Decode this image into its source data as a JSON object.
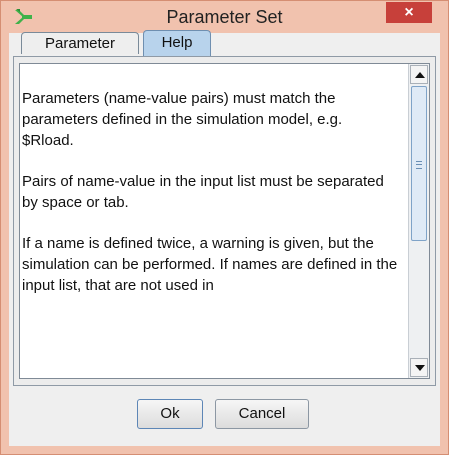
{
  "window": {
    "title": "Parameter Set",
    "close_label": "×",
    "app_icon": "green-arrow-icon",
    "accent_close": "#c7403a"
  },
  "tabs": [
    {
      "label": "Parameter",
      "active": false
    },
    {
      "label": "Help",
      "active": true
    }
  ],
  "help": {
    "paragraphs": [
      "Parameters (name-value pairs) must match the parameters defined in the simulation model, e.g. $Rload.",
      "Pairs of name-value in the input list must be separated by space or tab.",
      "If a name is defined twice, a warning is given, but the simulation can be performed. If names are defined in the input list, that are not used in"
    ]
  },
  "buttons": {
    "ok_label": "Ok",
    "cancel_label": "Cancel"
  }
}
